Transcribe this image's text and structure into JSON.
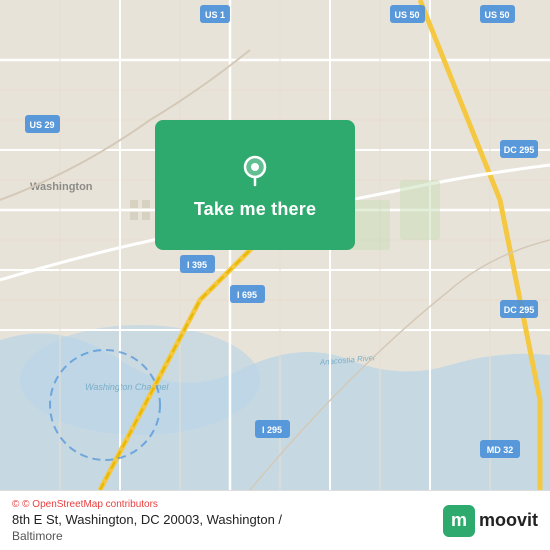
{
  "map": {
    "region": "Washington DC",
    "center_lat": 38.88,
    "center_lng": -77.01
  },
  "card": {
    "label": "Take me there",
    "pin_icon": "location-pin"
  },
  "footer": {
    "osm_credit": "© OpenStreetMap contributors",
    "address_line1": "8th E St, Washington, DC 20003, Washington /",
    "address_line2": "Baltimore",
    "moovit_label": "moovit"
  }
}
